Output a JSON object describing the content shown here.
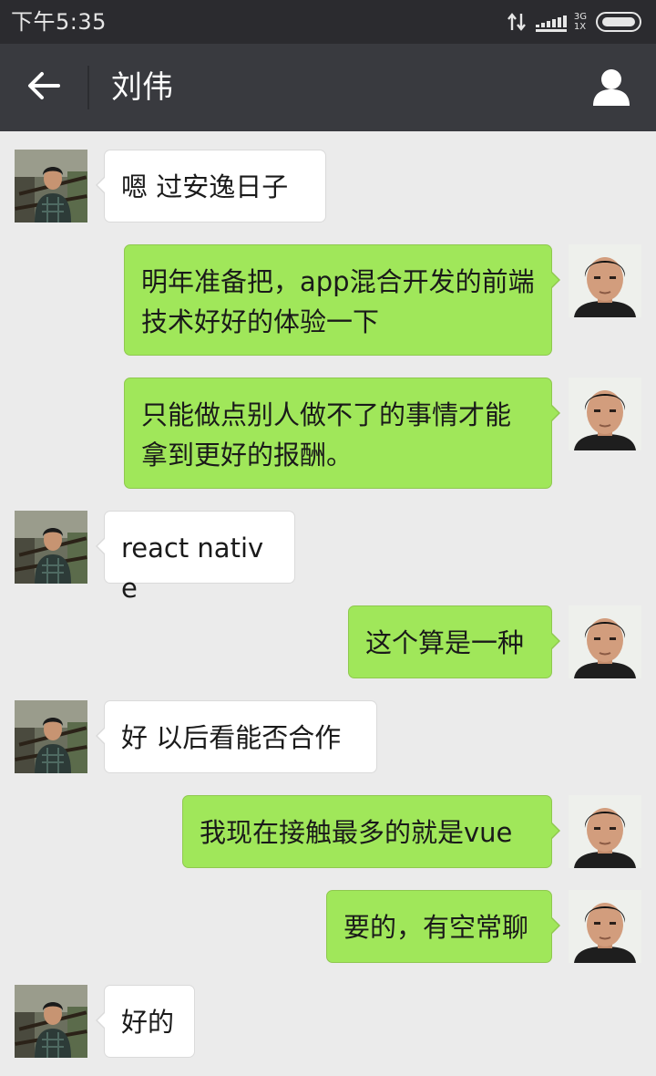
{
  "status_bar": {
    "time": "下午5:35",
    "network_type": "3G",
    "network_sub": "1X"
  },
  "header": {
    "title": "刘伟",
    "back_icon": "arrow-left-icon",
    "profile_icon": "person-icon"
  },
  "colors": {
    "background": "#ebebeb",
    "header": "#393a3f",
    "outgoing_bubble": "#a0e75a",
    "incoming_bubble": "#ffffff"
  },
  "messages": [
    {
      "side": "left",
      "text": "嗯 过安逸日子"
    },
    {
      "side": "right",
      "text": "明年准备把，app混合开发的前端技术好好的体验一下"
    },
    {
      "side": "right",
      "text": "只能做点别人做不了的事情才能拿到更好的报酬。"
    },
    {
      "side": "left",
      "text": "react native"
    },
    {
      "side": "right",
      "text": "这个算是一种"
    },
    {
      "side": "left",
      "text": "好 以后看能否合作"
    },
    {
      "side": "right",
      "text": "我现在接触最多的就是vue"
    },
    {
      "side": "right",
      "text": "要的，有空常聊"
    },
    {
      "side": "left",
      "text": "好的"
    }
  ]
}
